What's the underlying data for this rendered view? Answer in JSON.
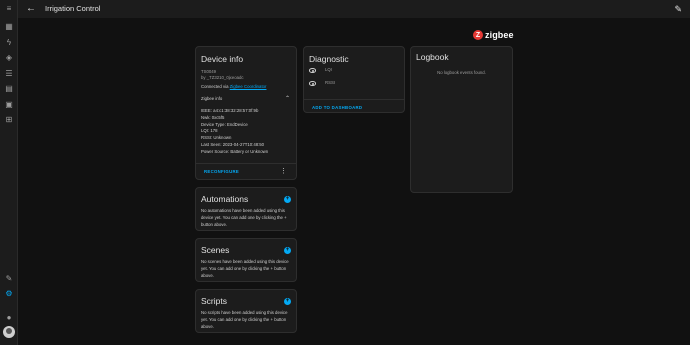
{
  "header": {
    "title": "Irrigation Control",
    "back_icon": "arrow-left-icon",
    "edit_icon": "pencil-icon"
  },
  "sidebar": {
    "items": [
      {
        "name": "menu-icon",
        "glyph": "≡"
      },
      {
        "name": "dashboard-icon",
        "glyph": "▦"
      },
      {
        "name": "energy-icon",
        "glyph": "ϟ"
      },
      {
        "name": "map-icon",
        "glyph": "◈"
      },
      {
        "name": "logbook-icon",
        "glyph": "☰"
      },
      {
        "name": "history-icon",
        "glyph": "▤"
      },
      {
        "name": "media-icon",
        "glyph": "▣"
      },
      {
        "name": "shopping-list-icon",
        "glyph": "⊞"
      },
      {
        "name": "developer-tools-icon",
        "glyph": "✎"
      },
      {
        "name": "settings-icon",
        "glyph": "⚙",
        "active": true
      },
      {
        "name": "notifications-icon",
        "glyph": "🔔"
      }
    ]
  },
  "brand": {
    "logo_letter": "Z",
    "text": "zigbee"
  },
  "device_info": {
    "title": "Device info",
    "model": "TS0049",
    "manufacturer": "by _TZ3210_0jxeoadc",
    "connected_prefix": "Connected via ",
    "connected_link": "Zigbee Coordinator",
    "zigbee_section": "Zigbee info",
    "lines": [
      "IEEE: a4:c1:38:32:28:57:0f:9b",
      "Nwk: 0xc5f5",
      "Device Type: EndDevice",
      "LQI: 178",
      "RSSI: Unknown",
      "Last Seen: 2023-04-27T10:48:50",
      "Power Source: Battery or Unknown"
    ],
    "reconfigure_label": "RECONFIGURE"
  },
  "diagnostic": {
    "title": "Diagnostic",
    "items": [
      "LQI",
      "RSSI"
    ],
    "add_label": "ADD TO DASHBOARD"
  },
  "logbook": {
    "title": "Logbook",
    "empty": "No logbook events found."
  },
  "automations": {
    "title": "Automations",
    "text": "No automations have been added using this device yet. You can add one by clicking the + button above."
  },
  "scenes": {
    "title": "Scenes",
    "text": "No scenes have been added using this device yet. You can add one by clicking the + button above."
  },
  "scripts": {
    "title": "Scripts",
    "text": "No scripts have been added using this device yet. You can add one by clicking the + button above."
  },
  "colors": {
    "accent": "#03a9f4",
    "background": "#111111",
    "card": "#1c1c1c",
    "zigbee": "#e53935"
  }
}
